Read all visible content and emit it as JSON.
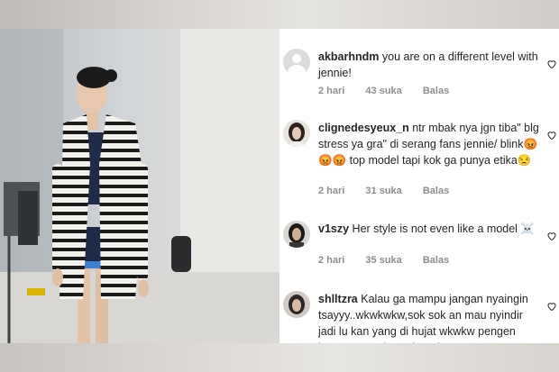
{
  "comments": [
    {
      "username": "akbarhndm",
      "text": "you are on a different level with jennie!",
      "time": "2 hari",
      "likes": "43 suka",
      "reply": "Balas",
      "avatar": "default-avatar-icon"
    },
    {
      "username": "clignedesyeux_n",
      "text": "ntr mbak nya jgn tiba\" blg stress ya gra\" di serang fans jennie/ blink😡😡😡 top model tapi kok ga punya etika😒",
      "time": "2 hari",
      "likes": "31 suka",
      "reply": "Balas",
      "avatar": "user-photo-avatar"
    },
    {
      "username": "v1szy",
      "text": "Her style is not even like a model ☠️",
      "time": "2 hari",
      "likes": "35 suka",
      "reply": "Balas",
      "avatar": "user-photo-avatar"
    },
    {
      "username": "shlltzra",
      "text": "Kalau ga mampu jangan nyaingin tsayyy..wkwkwkw,sok sok an mau nyindir jadi lu kan yang di hujat wkwkw pengen banget ya, Jd BA chanel",
      "time": "",
      "likes": "",
      "reply": "",
      "avatar": "user-photo-avatar"
    }
  ],
  "colors": {
    "text": "#262626",
    "meta": "#8e8e8e",
    "background": "#ffffff"
  }
}
